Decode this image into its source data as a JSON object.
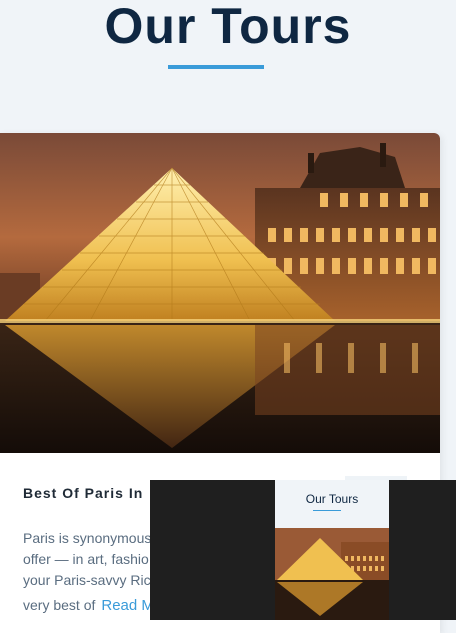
{
  "page": {
    "title": "Our Tours"
  },
  "tour": {
    "title": "Best Of Paris In",
    "lines": [
      "Paris is synonymous",
      "offer — in art, fashio",
      "your Paris-savvy Rick",
      "very best of"
    ],
    "read_more": "Read M"
  },
  "preview": {
    "title": "Our Tours"
  },
  "colors": {
    "heading": "#0f2742",
    "accent": "#3a9bd9",
    "background": "#f0f4f8",
    "body_text": "#5a6d80",
    "overlay": "#1f1f1f"
  }
}
